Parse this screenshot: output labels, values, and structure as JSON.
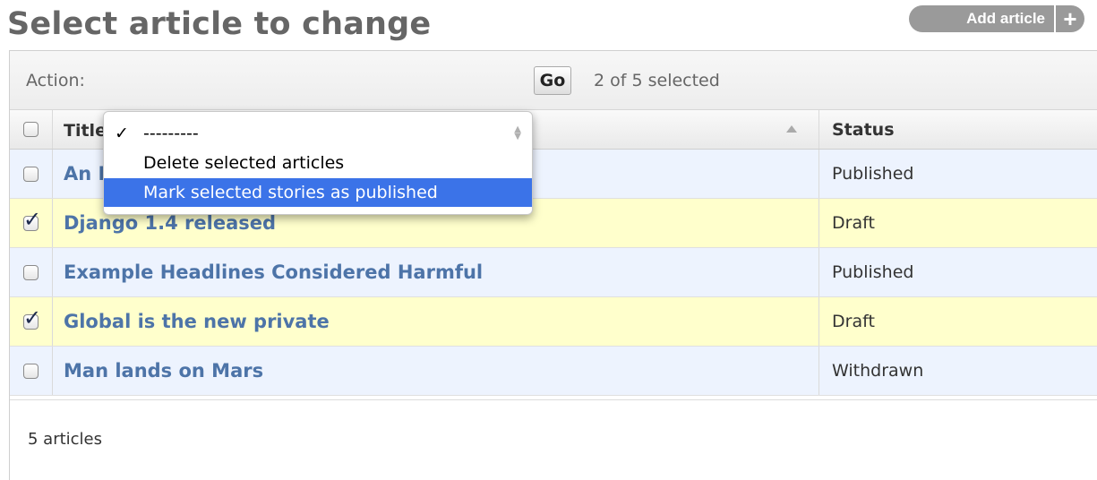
{
  "header": {
    "title": "Select article to change",
    "add_button_label": "Add article",
    "add_button_icon": "+"
  },
  "actions": {
    "label": "Action:",
    "go_label": "Go",
    "counter": "2 of 5 selected",
    "dropdown": {
      "options": [
        {
          "label": "---------",
          "checked": true,
          "highlighted": false
        },
        {
          "label": "Delete selected articles",
          "checked": false,
          "highlighted": false
        },
        {
          "label": "Mark selected stories as published",
          "checked": false,
          "highlighted": true
        }
      ],
      "check_glyph": "✓"
    }
  },
  "table": {
    "columns": {
      "title": "Title",
      "status": "Status"
    },
    "rows": [
      {
        "title": "An Excercise in Species Barcoding",
        "status": "Published",
        "checked": false
      },
      {
        "title": "Django 1.4 released",
        "status": "Draft",
        "checked": true
      },
      {
        "title": "Example Headlines Considered Harmful",
        "status": "Published",
        "checked": false
      },
      {
        "title": "Global is the new private",
        "status": "Draft",
        "checked": true
      },
      {
        "title": "Man lands on Mars",
        "status": "Withdrawn",
        "checked": false
      }
    ]
  },
  "paginator": {
    "count_text": "5 articles"
  },
  "colors": {
    "link": "#4d74a8",
    "selected_row": "#ffffcc",
    "row": "#edf3fe",
    "highlight": "#3b73e8"
  }
}
